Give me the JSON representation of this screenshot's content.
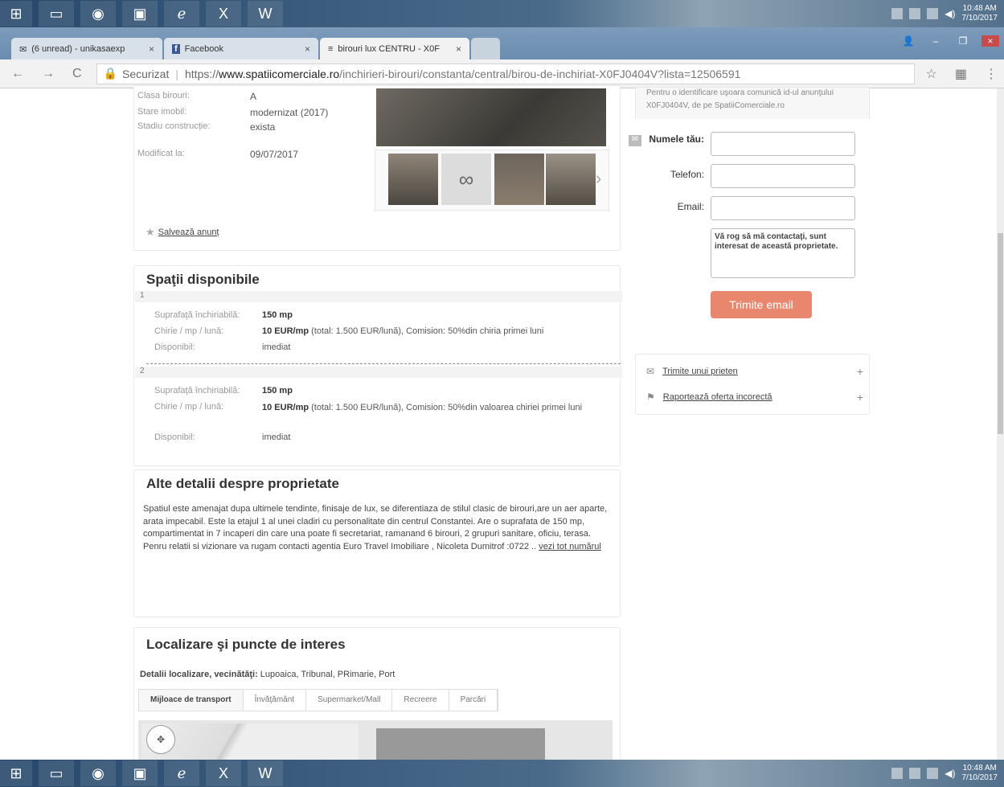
{
  "taskbar": {
    "time": "10:48 AM",
    "date": "7/10/2017"
  },
  "browser": {
    "tabs": [
      {
        "label": "(6 unread) - unikasaexp"
      },
      {
        "label": "Facebook"
      },
      {
        "label": "birouri lux CENTRU - X0F"
      }
    ],
    "secure_label": "Securizat",
    "url_scheme": "https://",
    "url_domain": "www.spatiicomerciale.ro",
    "url_path": "/inchirieri-birouri/constanta/central/birou-de-inchiriat-X0FJ0404V?lista=12506591"
  },
  "details": [
    {
      "label": "Clasa birouri:",
      "value": "A"
    },
    {
      "label": "Stare imobil:",
      "value": "modernizat (2017)"
    },
    {
      "label": "Stadiu construcție:",
      "value": "exista"
    },
    {
      "label": "Modificat la:",
      "value": "09/07/2017"
    }
  ],
  "save_link": "Salvează anunț",
  "spaces": {
    "title": "Spaţii disponibile",
    "items": [
      {
        "num": "1",
        "area_label": "Suprafaţă închiriabilă:",
        "area": "150 mp",
        "rent_label": "Chirie / mp / lună:",
        "rent_bold": "10 EUR/mp",
        "rent_rest": "(total: 1.500 EUR/lună), Comision: 50%din chiria primei luni",
        "avail_label": "Disponibil:",
        "avail": "imediat"
      },
      {
        "num": "2",
        "area_label": "Suprafaţă închiriabilă:",
        "area": "150 mp",
        "rent_label": "Chirie / mp / lună:",
        "rent_bold": "10 EUR/mp",
        "rent_rest": "(total: 1.500 EUR/lună), Comision: 50%din valoarea chiriei primei luni",
        "avail_label": "Disponibil:",
        "avail": "imediat"
      }
    ]
  },
  "description": {
    "title": "Alte detalii despre proprietate",
    "text": "Spatiul este amenajat dupa ultimele tendinte, finisaje de lux, se diferentiaza de stilul clasic de birouri,are un aer aparte, arata impecabil. Este la etajul 1 al unei cladiri cu personalitate din centrul Constantei. Are o suprafata de 150 mp, compartimentat in 7 incaperi din care una poate fi secretariat, ramanand 6 birouri, 2 grupuri sanitare, oficiu, terasa. Penru relatii si vizionare va rugam contacti agentia Euro Travel Imobiliare , Nicoleta Dumitrof :0722 ..",
    "more_link": "vezi tot numărul"
  },
  "location": {
    "title": "Localizare şi puncte de interes",
    "details_label": "Detalii localizare, vecinătăţi:",
    "details_value": "Lupoaica, Tribunal, PRimarie, Port",
    "tabs": [
      "Mijloace de transport",
      "Învăţământ",
      "Supermarket/Mall",
      "Recreere",
      "Parcări"
    ]
  },
  "contact": {
    "note_prefix": "Pentru o identificare uşoara comunică id-ul anunţului",
    "note_id": "X0FJ0404V, de pe SpatiiComerciale.ro",
    "name_label": "Numele tău:",
    "phone_label": "Telefon:",
    "email_label": "Email:",
    "message": "Vă rog să mă contactaţi, sunt interesat de această proprietate.",
    "send_button": "Trimite email"
  },
  "side_links": [
    {
      "label": "Trimite unui prieten"
    },
    {
      "label": "Raportează oferta incorectă"
    }
  ]
}
